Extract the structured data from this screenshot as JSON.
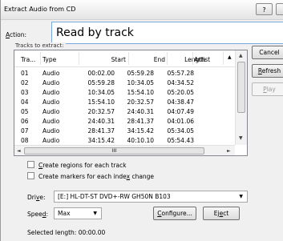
{
  "window": {
    "title": "Extract Audio from CD",
    "help_button": "?"
  },
  "action": {
    "label_key": "A",
    "label_rest": "ction:",
    "value": "Read by track"
  },
  "tracks_group_label": "Tracks to extract:",
  "columns": [
    "Tra...",
    "Type",
    "Start",
    "End",
    "Length",
    "Artist"
  ],
  "tracks": [
    {
      "track": "01",
      "type": "Audio",
      "start": "00:02.00",
      "end": "05:59.28",
      "length": "05:57.28"
    },
    {
      "track": "02",
      "type": "Audio",
      "start": "05:59.28",
      "end": "10:34.05",
      "length": "04:34.52"
    },
    {
      "track": "03",
      "type": "Audio",
      "start": "10:34.05",
      "end": "15:54.10",
      "length": "05:20.05"
    },
    {
      "track": "04",
      "type": "Audio",
      "start": "15:54.10",
      "end": "20:32.57",
      "length": "04:38.47"
    },
    {
      "track": "05",
      "type": "Audio",
      "start": "20:32.57",
      "end": "24:40.31",
      "length": "04:07.49"
    },
    {
      "track": "06",
      "type": "Audio",
      "start": "24:40.31",
      "end": "28:41.37",
      "length": "04:01.06"
    },
    {
      "track": "07",
      "type": "Audio",
      "start": "28:41.37",
      "end": "34:15.42",
      "length": "05:34.05"
    },
    {
      "track": "08",
      "type": "Audio",
      "start": "34:15.42",
      "end": "40:10.10",
      "length": "05:54.43"
    }
  ],
  "hscroll_grip": "III",
  "buttons": {
    "cancel": "Cancel",
    "refresh_key": "R",
    "refresh_rest": "efresh",
    "play_key": "P",
    "play_rest": "lay"
  },
  "options": {
    "regions_key": "C",
    "regions_rest": "reate regions for each track",
    "markers_pre": "Create markers for each inde",
    "markers_key": "x",
    "markers_rest": " change"
  },
  "drive": {
    "label_pre": "Dri",
    "label_key": "v",
    "label_post": "e:",
    "value": "[E:] HL-DT-ST DVD+-RW GH50N B103"
  },
  "speed": {
    "label_pre": "Spee",
    "label_key": "d",
    "label_post": ":",
    "value": "Max"
  },
  "configure": {
    "pre": "",
    "key": "C",
    "rest": "onfigure..."
  },
  "eject": {
    "pre": "Ej",
    "key": "e",
    "rest": "ct"
  },
  "selected_length": {
    "label": "Selected length:",
    "value": "00:00.00"
  }
}
